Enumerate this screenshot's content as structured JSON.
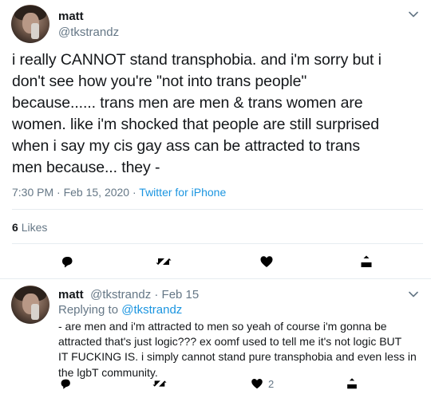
{
  "main_tweet": {
    "author_name": "matt",
    "author_handle": "@tkstrandz",
    "text": "i really CANNOT stand transphobia. and i'm sorry but i\ndon't see how you're \"not into trans people\"\nbecause...... trans men are men & trans women are\nwomen. like i'm shocked that people are still surprised\nwhen i say my cis gay ass can be attracted to trans\nmen because... they -",
    "timestamp": "7:30 PM · Feb 15, 2020",
    "separator": " · ",
    "source": "Twitter for iPhone",
    "likes_count": "6",
    "likes_label": "Likes"
  },
  "reply_tweet": {
    "author_name": "matt",
    "author_handle_date": "@tkstrandz · Feb 15",
    "replying_prefix": "Replying to ",
    "replying_handle": "@tkstrandz",
    "text": "- are men and i'm attracted to men so yeah of course i'm gonna be\nattracted that's just logic??? ex oomf used to tell me it's not logic BUT\nIT FUCKING IS. i simply cannot stand pure transphobia and even less in\nthe lgbT community.",
    "like_count": "2"
  },
  "icons": [
    "reply-icon",
    "retweet-icon",
    "like-icon",
    "share-icon",
    "chevron-down-icon"
  ],
  "colors": {
    "link": "#1b95e0",
    "secondary": "#657786",
    "text": "#14171a",
    "divider": "#e6ecf0"
  }
}
